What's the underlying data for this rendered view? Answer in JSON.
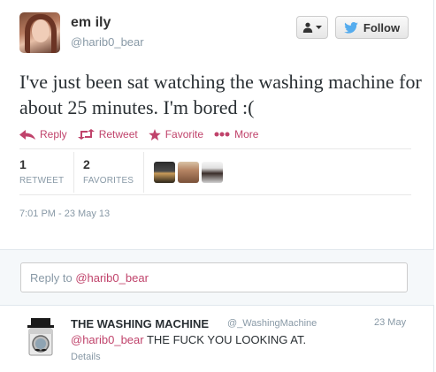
{
  "header": {
    "display_name": "em ily",
    "screen_name": "@harib0_bear",
    "follow_label": "Follow"
  },
  "tweet": {
    "text": "I've just been sat watching the washing machine for about 25 minutes. I'm bored :("
  },
  "actions": {
    "reply": "Reply",
    "retweet": "Retweet",
    "favorite": "Favorite",
    "more": "More"
  },
  "stats": {
    "retweets_count": "1",
    "retweets_label": "RETWEET",
    "favorites_count": "2",
    "favorites_label": "FAVORITES"
  },
  "timestamp": "7:01 PM - 23 May 13",
  "reply_box": {
    "prefix": "Reply to ",
    "handle": "@harib0_bear"
  },
  "reply_tweet": {
    "name": "THE WASHING MACHINE",
    "handle": "@_WashingMachine",
    "date": "23 May",
    "mention": "@harib0_bear",
    "text": " THE FUCK YOU LOOKING AT.",
    "details": "Details"
  },
  "colors": {
    "accent": "#c0436b",
    "muted": "#8899a6",
    "twitter_blue": "#55acee"
  }
}
